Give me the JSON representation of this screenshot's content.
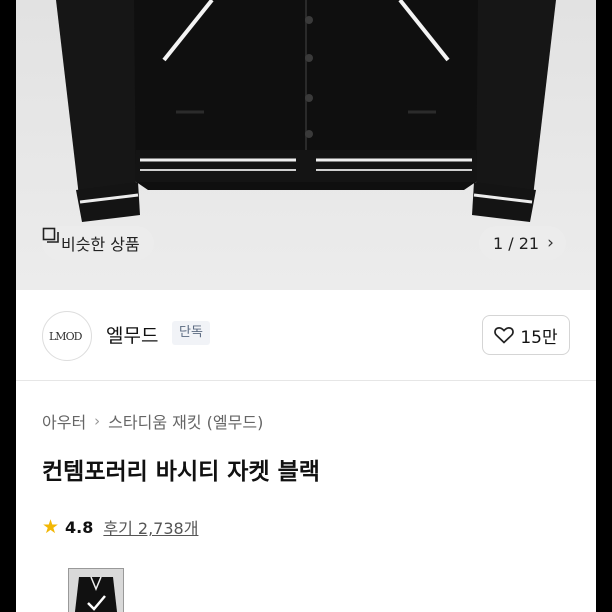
{
  "hero": {
    "similar_label": "비슷한 상품",
    "counter": "1 / 21",
    "counter_chevron": "›"
  },
  "brand": {
    "logo_text": "LMOD",
    "name": "엘무드",
    "tag": "단독",
    "likes": "15만"
  },
  "breadcrumb": [
    "아우터",
    "스타디움 재킷 (엘무드)"
  ],
  "breadcrumb_sep": "›",
  "product": {
    "title": "컨템포러리 바시티 자켓 블랙",
    "rating": "4.8",
    "reviews": "후기 2,738개"
  },
  "colors": {
    "star": "#f2b705",
    "jacket": "#111111"
  },
  "icons": [
    "similar-items-icon",
    "chevron-right-icon",
    "heart-icon",
    "star-icon",
    "check-icon"
  ]
}
